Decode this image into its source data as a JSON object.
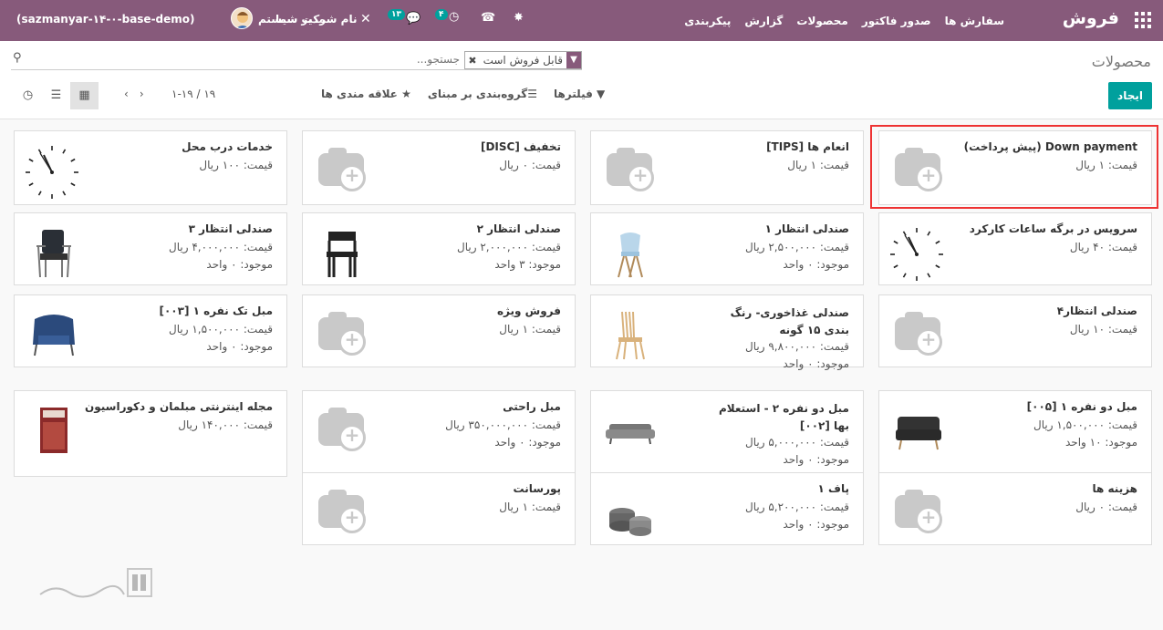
{
  "topbar": {
    "brand": "فروش",
    "menu": [
      "سفارش ها",
      "صدور فاکتور",
      "محصولات",
      "گزارش",
      "پیکربندی"
    ],
    "company": "نام شرکت شما",
    "user_role": "مدیر سیستم",
    "user_name": "(sazmanyar-۱۴-۰-base-demo)",
    "chat_count": "۱۳",
    "activity_count": "۴"
  },
  "control_panel": {
    "title": "محصولات",
    "facet": "قابل فروش است",
    "search_placeholder": "جستجو...",
    "create": "ایجاد",
    "filters": "فیلترها",
    "groupby": "گروه‌بندی بر مبنای",
    "favorites": "علاقه مندی ها",
    "pager": "۱-۱۹ / ۱۹"
  },
  "products": [
    {
      "name": "Down payment (پیش پرداخت)",
      "lines": [
        "قیمت: ۱ ریال"
      ],
      "image": "camera-placeholder"
    },
    {
      "name": "انعام ها [TIPS]",
      "lines": [
        "قیمت: ۱ ریال"
      ],
      "image": "camera-placeholder"
    },
    {
      "name": "تخفیف [DISC]",
      "lines": [
        "قیمت: ۰ ریال"
      ],
      "image": "camera-placeholder"
    },
    {
      "name": "خدمات درب محل",
      "lines": [
        "قیمت: ۱۰۰ ریال"
      ],
      "image": "clock"
    },
    {
      "name": "سرویس در برگه ساعات کارکرد",
      "lines": [
        "قیمت: ۴۰ ریال"
      ],
      "image": "clock"
    },
    {
      "name": "صندلی انتظار ۱",
      "lines": [
        "قیمت: ۲,۵۰۰,۰۰۰ ریال",
        "موجود: ۰ واحد"
      ],
      "image": "chair-blue"
    },
    {
      "name": "صندلی انتظار ۲",
      "lines": [
        "قیمت: ۲,۰۰۰,۰۰۰ ریال",
        "موجود: ۳ واحد"
      ],
      "image": "chair-black"
    },
    {
      "name": "صندلی انتظار ۳",
      "lines": [
        "قیمت: ۴,۰۰۰,۰۰۰ ریال",
        "موجود: ۰ واحد"
      ],
      "image": "chair-black-arm"
    },
    {
      "name": "صندلی انتظار۴",
      "lines": [
        "قیمت: ۱۰ ریال"
      ],
      "image": "camera-placeholder"
    },
    {
      "name": "صندلی غذاخوری- رنگ بندی ۱۵ گونه",
      "lines": [
        "قیمت: ۹,۸۰۰,۰۰۰ ریال",
        "موجود: ۰ واحد"
      ],
      "image": "chair-wood"
    },
    {
      "name": "فروش ویژه",
      "lines": [
        "قیمت: ۱ ریال"
      ],
      "image": "camera-placeholder"
    },
    {
      "name": "مبل تک نفره ۱ [۰۰۳]",
      "lines": [
        "قیمت: ۱,۵۰۰,۰۰۰ ریال",
        "موجود: ۰ واحد"
      ],
      "image": "armchair-blue"
    },
    {
      "name": "مبل دو نفره ۱ [۰۰۵]",
      "lines": [
        "قیمت: ۱,۵۰۰,۰۰۰ ریال",
        "موجود: ۱۰ واحد"
      ],
      "image": "sofa-dark"
    },
    {
      "name": "مبل دو نفره ۲ - استعلام بها [۰۰۲]",
      "lines": [
        "قیمت: ۵,۰۰۰,۰۰۰ ریال",
        "موجود: ۰ واحد"
      ],
      "image": "sofa-grey"
    },
    {
      "name": "مبل راحتی",
      "lines": [
        "قیمت: ۳۵۰,۰۰۰,۰۰۰ ریال",
        "موجود: ۰ واحد"
      ],
      "image": "camera-placeholder"
    },
    {
      "name": "مجله اینترنتی مبلمان و دکوراسیون",
      "lines": [
        "قیمت: ۱۴۰,۰۰۰ ریال"
      ],
      "image": "magazine"
    },
    {
      "name": "هزینه ها",
      "lines": [
        "قیمت: ۰ ریال"
      ],
      "image": "camera-placeholder"
    },
    {
      "name": "پاف ۱",
      "lines": [
        "قیمت: ۵,۲۰۰,۰۰۰ ریال",
        "موجود: ۰ واحد"
      ],
      "image": "pouf"
    },
    {
      "name": "پورسانت",
      "lines": [
        "قیمت: ۱ ریال"
      ],
      "image": "camera-placeholder"
    }
  ]
}
